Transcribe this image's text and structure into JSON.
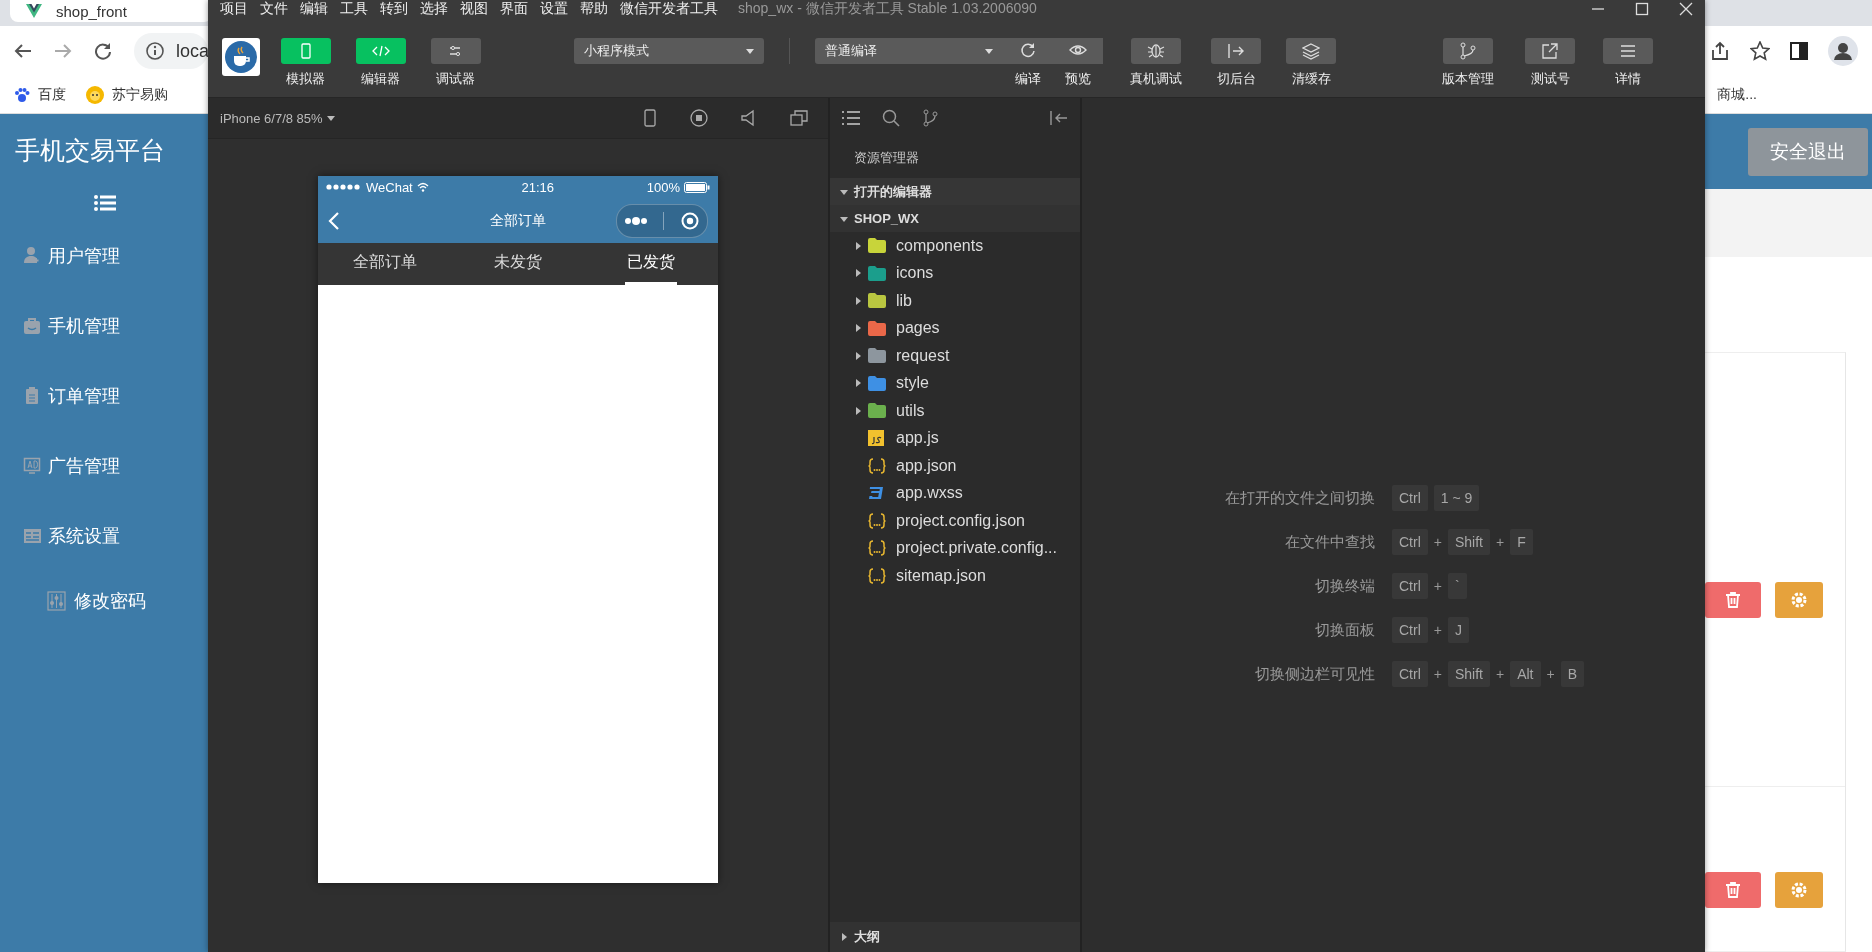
{
  "browser": {
    "tab_title": "shop_front",
    "address": "loca",
    "bookmarks": [
      {
        "label": "百度",
        "kind": "paw"
      },
      {
        "label": "苏宁易购",
        "kind": "lion"
      }
    ],
    "bookmark_overflow": "商城..."
  },
  "admin": {
    "brand": "手机交易平台",
    "logout": "安全退出",
    "menu": [
      {
        "label": "用户管理",
        "kind": "user"
      },
      {
        "label": "手机管理",
        "kind": "bag"
      },
      {
        "label": "订单管理",
        "kind": "clipboard"
      },
      {
        "label": "广告管理",
        "kind": "ad"
      },
      {
        "label": "系统设置",
        "kind": "panel",
        "children": [
          {
            "label": "修改密码",
            "kind": "sliders"
          }
        ]
      }
    ]
  },
  "devtools": {
    "menu": [
      "项目",
      "文件",
      "编辑",
      "工具",
      "转到",
      "选择",
      "视图",
      "界面",
      "设置",
      "帮助",
      "微信开发者工具"
    ],
    "title": "shop_wx - 微信开发者工具 Stable 1.03.2006090",
    "panels": [
      {
        "label": "模拟器",
        "kind": "phone",
        "on": true
      },
      {
        "label": "编辑器",
        "kind": "code",
        "on": true
      },
      {
        "label": "调试器",
        "kind": "debug",
        "on": false
      }
    ],
    "mode_select": "小程序模式",
    "compile_select": "普通编译",
    "actions": [
      {
        "label": "编译",
        "kind": "refresh"
      },
      {
        "label": "预览",
        "kind": "eye"
      },
      {
        "label": "真机调试",
        "kind": "bug"
      },
      {
        "label": "切后台",
        "kind": "exit"
      },
      {
        "label": "清缓存",
        "kind": "layers"
      },
      {
        "label": "版本管理",
        "kind": "branch"
      },
      {
        "label": "测试号",
        "kind": "share"
      },
      {
        "label": "详情",
        "kind": "menu"
      }
    ],
    "simulator": {
      "device": "iPhone 6/7/8 85%",
      "carrier": "WeChat",
      "time": "21:16",
      "battery": "100%",
      "nav_title": "全部订单",
      "tabs": [
        {
          "label": "全部订单",
          "selected": false
        },
        {
          "label": "未发货",
          "selected": false
        },
        {
          "label": "已发货",
          "selected": true
        }
      ]
    },
    "explorer": {
      "title": "资源管理器",
      "sections": [
        {
          "label": "打开的编辑器",
          "expanded": true
        },
        {
          "label": "SHOP_WX",
          "expanded": true
        }
      ],
      "tree": [
        {
          "name": "components",
          "kind": "folder",
          "color": "#c8d43a",
          "expanded": false
        },
        {
          "name": "icons",
          "kind": "folder",
          "color": "#1b9e8c",
          "expanded": false
        },
        {
          "name": "lib",
          "kind": "folder",
          "color": "#b9c640",
          "expanded": false
        },
        {
          "name": "pages",
          "kind": "folder",
          "color": "#ea6849",
          "expanded": false
        },
        {
          "name": "request",
          "kind": "folder",
          "color": "#8d969e",
          "expanded": false
        },
        {
          "name": "style",
          "kind": "folder",
          "color": "#3e90e4",
          "expanded": false
        },
        {
          "name": "utils",
          "kind": "folder",
          "color": "#6bb04d",
          "expanded": false
        },
        {
          "name": "app.js",
          "kind": "js"
        },
        {
          "name": "app.json",
          "kind": "json"
        },
        {
          "name": "app.wxss",
          "kind": "css"
        },
        {
          "name": "project.config.json",
          "kind": "json"
        },
        {
          "name": "project.private.config...",
          "kind": "json"
        },
        {
          "name": "sitemap.json",
          "kind": "json"
        }
      ],
      "outline": {
        "label": "大纲",
        "expanded": false
      }
    },
    "shortcuts": [
      {
        "label": "在打开的文件之间切换",
        "keys": [
          {
            "kind": "key",
            "text": "Ctrl"
          },
          {
            "kind": "key",
            "text": "1 ~ 9"
          }
        ]
      },
      {
        "label": "在文件中查找",
        "keys": [
          {
            "kind": "key",
            "text": "Ctrl"
          },
          {
            "kind": "plus",
            "text": "+"
          },
          {
            "kind": "key",
            "text": "Shift"
          },
          {
            "kind": "plus",
            "text": "+"
          },
          {
            "kind": "key",
            "text": "F"
          }
        ]
      },
      {
        "label": "切换终端",
        "keys": [
          {
            "kind": "key",
            "text": "Ctrl"
          },
          {
            "kind": "plus",
            "text": "+"
          },
          {
            "kind": "key",
            "text": "`"
          }
        ]
      },
      {
        "label": "切换面板",
        "keys": [
          {
            "kind": "key",
            "text": "Ctrl"
          },
          {
            "kind": "plus",
            "text": "+"
          },
          {
            "kind": "key",
            "text": "J"
          }
        ]
      },
      {
        "label": "切换侧边栏可见性",
        "keys": [
          {
            "kind": "key",
            "text": "Ctrl"
          },
          {
            "kind": "plus",
            "text": "+"
          },
          {
            "kind": "key",
            "text": "Shift"
          },
          {
            "kind": "plus",
            "text": "+"
          },
          {
            "kind": "key",
            "text": "Alt"
          },
          {
            "kind": "plus",
            "text": "+"
          },
          {
            "kind": "key",
            "text": "B"
          }
        ]
      }
    ]
  }
}
